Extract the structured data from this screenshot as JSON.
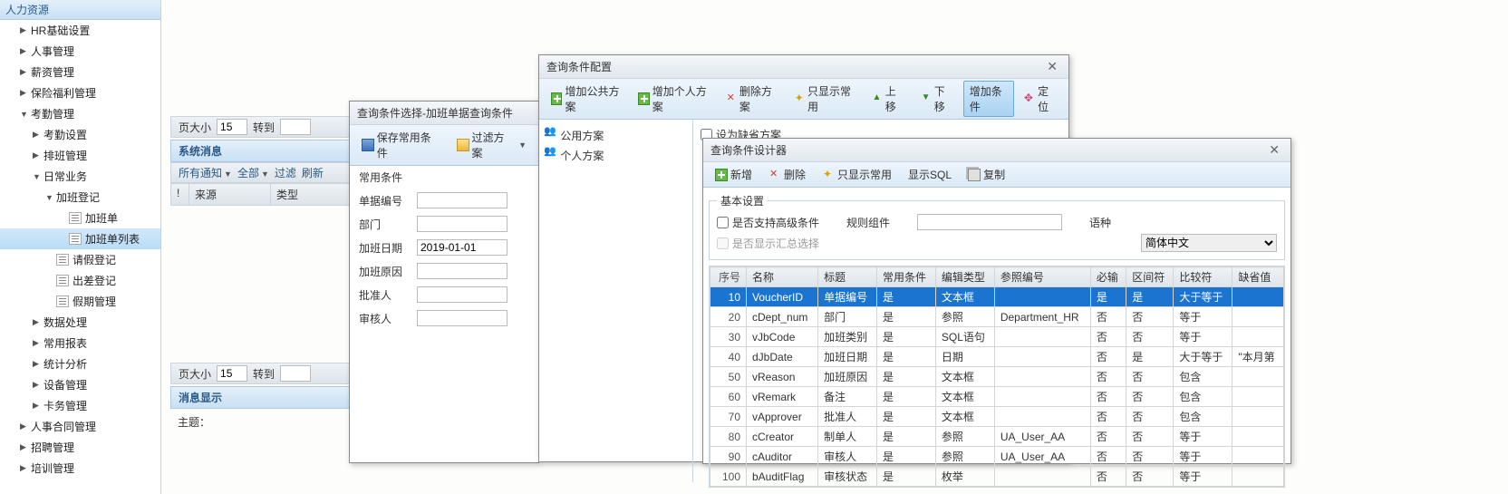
{
  "sidebar": {
    "header": "人力资源",
    "items": [
      {
        "label": "HR基础设置",
        "tri": "▶",
        "indent": 1
      },
      {
        "label": "人事管理",
        "tri": "▶",
        "indent": 1
      },
      {
        "label": "薪资管理",
        "tri": "▶",
        "indent": 1
      },
      {
        "label": "保险福利管理",
        "tri": "▶",
        "indent": 1
      },
      {
        "label": "考勤管理",
        "tri": "▼",
        "indent": 1
      },
      {
        "label": "考勤设置",
        "tri": "▶",
        "indent": 2
      },
      {
        "label": "排班管理",
        "tri": "▶",
        "indent": 2
      },
      {
        "label": "日常业务",
        "tri": "▼",
        "indent": 2
      },
      {
        "label": "加班登记",
        "tri": "▼",
        "indent": 3
      },
      {
        "label": "加班单",
        "tri": "",
        "indent": 4,
        "doc": true
      },
      {
        "label": "加班单列表",
        "tri": "",
        "indent": 4,
        "doc": true,
        "sel": true
      },
      {
        "label": "请假登记",
        "tri": "",
        "indent": 3,
        "doc": true
      },
      {
        "label": "出差登记",
        "tri": "",
        "indent": 3,
        "doc": true
      },
      {
        "label": "假期管理",
        "tri": "",
        "indent": 3,
        "doc": true
      },
      {
        "label": "数据处理",
        "tri": "▶",
        "indent": 2
      },
      {
        "label": "常用报表",
        "tri": "▶",
        "indent": 2
      },
      {
        "label": "统计分析",
        "tri": "▶",
        "indent": 2
      },
      {
        "label": "设备管理",
        "tri": "▶",
        "indent": 2
      },
      {
        "label": "卡务管理",
        "tri": "▶",
        "indent": 2
      },
      {
        "label": "人事合同管理",
        "tri": "▶",
        "indent": 1
      },
      {
        "label": "招聘管理",
        "tri": "▶",
        "indent": 1
      },
      {
        "label": "培训管理",
        "tri": "▶",
        "indent": 1
      }
    ]
  },
  "pager_top": {
    "page_size_label": "页大小",
    "page_size": "15",
    "goto_label": "转到"
  },
  "pager_bottom": {
    "page_size_label": "页大小",
    "page_size": "15",
    "goto_label": "转到"
  },
  "sysmsg_header": "系统消息",
  "sysmsg_toolbar": {
    "all_notify": "所有通知",
    "all": "全部",
    "filter": "过滤",
    "refresh": "刷新"
  },
  "sysmsg_cols": {
    "bang": "!",
    "source": "来源",
    "type": "类型"
  },
  "msgdisp_header": "消息显示",
  "msgdisp_label": "主题：",
  "win_filter": {
    "title": "查询条件选择-加班单据查询条件",
    "save": "保存常用条件",
    "filter_plan": "过滤方案",
    "group": "常用条件",
    "fields": {
      "voucher": "单据编号",
      "dept": "部门",
      "date_label": "加班日期",
      "date_value": "2019-01-01",
      "reason": "加班原因",
      "approver": "批准人",
      "auditor": "审核人"
    }
  },
  "win_config": {
    "title": "查询条件配置",
    "buttons": {
      "add_public": "增加公共方案",
      "add_personal": "增加个人方案",
      "delete": "删除方案",
      "show_common": "只显示常用",
      "up": "上移",
      "down": "下移",
      "add_cond": "增加条件",
      "locate": "定位"
    },
    "tree": {
      "public": "公用方案",
      "personal": "个人方案"
    },
    "set_default": "设为缺省方案"
  },
  "win_designer": {
    "title": "查询条件设计器",
    "buttons": {
      "add": "新增",
      "delete": "删除",
      "show_common": "只显示常用",
      "show_sql": "显示SQL",
      "copy": "复制"
    },
    "basic_legend": "基本设置",
    "adv_check": "是否支持高级条件",
    "sum_check": "是否显示汇总选择",
    "rule_label": "规则组件",
    "lang_label": "语种",
    "lang_value": "简体中文",
    "cols": {
      "seq": "序号",
      "name": "名称",
      "title": "标题",
      "common": "常用条件",
      "edit": "编辑类型",
      "ref": "参照编号",
      "req": "必输",
      "range": "区间符",
      "cmp": "比较符",
      "def": "缺省值"
    },
    "rows": [
      {
        "seq": "10",
        "name": "VoucherID",
        "title": "单据编号",
        "common": "是",
        "edit": "文本框",
        "ref": "",
        "req": "是",
        "range": "是",
        "cmp": "大于等于",
        "def": "",
        "sel": true
      },
      {
        "seq": "20",
        "name": "cDept_num",
        "title": "部门",
        "common": "是",
        "edit": "参照",
        "ref": "Department_HR",
        "req": "否",
        "range": "否",
        "cmp": "等于",
        "def": ""
      },
      {
        "seq": "30",
        "name": "vJbCode",
        "title": "加班类别",
        "common": "是",
        "edit": "SQL语句",
        "ref": "",
        "req": "否",
        "range": "否",
        "cmp": "等于",
        "def": ""
      },
      {
        "seq": "40",
        "name": "dJbDate",
        "title": "加班日期",
        "common": "是",
        "edit": "日期",
        "ref": "",
        "req": "否",
        "range": "是",
        "cmp": "大于等于",
        "def": "\"本月第"
      },
      {
        "seq": "50",
        "name": "vReason",
        "title": "加班原因",
        "common": "是",
        "edit": "文本框",
        "ref": "",
        "req": "否",
        "range": "否",
        "cmp": "包含",
        "def": ""
      },
      {
        "seq": "60",
        "name": "vRemark",
        "title": "备注",
        "common": "是",
        "edit": "文本框",
        "ref": "",
        "req": "否",
        "range": "否",
        "cmp": "包含",
        "def": ""
      },
      {
        "seq": "70",
        "name": "vApprover",
        "title": "批准人",
        "common": "是",
        "edit": "文本框",
        "ref": "",
        "req": "否",
        "range": "否",
        "cmp": "包含",
        "def": ""
      },
      {
        "seq": "80",
        "name": "cCreator",
        "title": "制单人",
        "common": "是",
        "edit": "参照",
        "ref": "UA_User_AA",
        "req": "否",
        "range": "否",
        "cmp": "等于",
        "def": ""
      },
      {
        "seq": "90",
        "name": "cAuditor",
        "title": "审核人",
        "common": "是",
        "edit": "参照",
        "ref": "UA_User_AA",
        "req": "否",
        "range": "否",
        "cmp": "等于",
        "def": ""
      },
      {
        "seq": "100",
        "name": "bAuditFlag",
        "title": "审核状态",
        "common": "是",
        "edit": "枚举",
        "ref": "",
        "req": "否",
        "range": "否",
        "cmp": "等于",
        "def": ""
      }
    ]
  }
}
